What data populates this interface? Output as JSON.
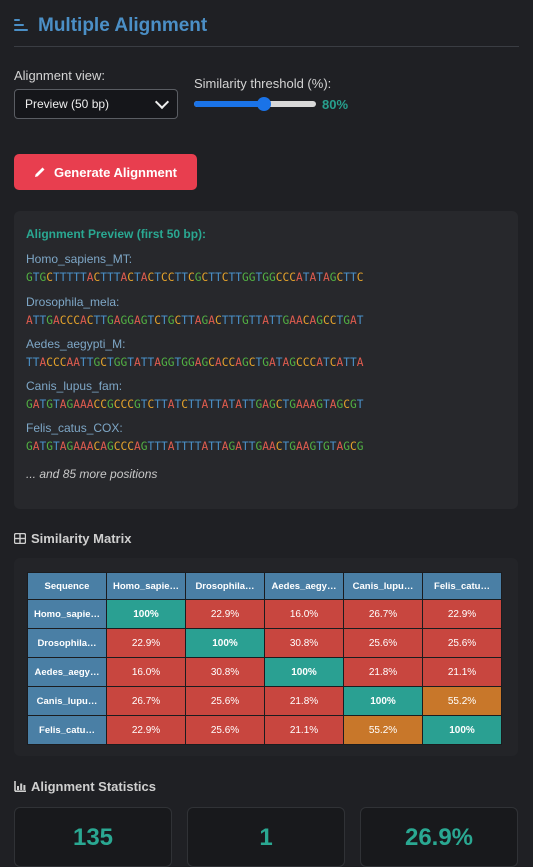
{
  "header": {
    "title": "Multiple Alignment",
    "icon": "align-left-icon"
  },
  "controls": {
    "view_label": "Alignment view:",
    "view_value": "Preview (50 bp)",
    "threshold_label": "Similarity threshold (%):",
    "threshold_value_text": "80%",
    "threshold_value": 80,
    "threshold_slider_fraction": 0.57
  },
  "generate_button": {
    "label": "Generate Alignment",
    "color": "#e83e4f"
  },
  "preview": {
    "title": "Alignment Preview (first 50 bp):",
    "sequences": [
      {
        "name": "Homo_sapiens_MT:",
        "seq": "GTGCTTTTTACTTTACTACTCCTTCGCTTCTTGGTGGCCCATATAGCTTC"
      },
      {
        "name": "Drosophila_mela:",
        "seq": "ATTGACCCACTTGAGGAGTCTGCTTAGACTTTGTTATTGAACAGCCTGAT"
      },
      {
        "name": "Aedes_aegypti_M:",
        "seq": "TTACCCAATTGCTGGTATTAGGTGGAGCACCAGCTGATAGCCCATCATTA"
      },
      {
        "name": "Canis_lupus_fam:",
        "seq": "GATGTAGAAACCGCCCGTCTTATCTTATTATATTGAGCTGAAAGTAGCGT"
      },
      {
        "name": "Felis_catus_COX:",
        "seq": "GATGTAGAAACAGCCCAGTTTATTTTATTAGATTGAACTGAAGTGTAGCG"
      }
    ],
    "more_text": "... and 85 more positions",
    "base_colors": {
      "A": "#e05c4f",
      "T": "#4a90c8",
      "G": "#52b043",
      "C": "#e5a32b"
    }
  },
  "similarity": {
    "title": "Similarity Matrix",
    "corner_header": "Sequence",
    "columns": [
      "Homo_sapie…",
      "Drosophila…",
      "Aedes_aegy…",
      "Canis_lupu…",
      "Felis_catu…"
    ],
    "rows": [
      {
        "label": "Homo_sapie…",
        "cells": [
          "100%",
          "22.9%",
          "16.0%",
          "26.7%",
          "22.9%"
        ]
      },
      {
        "label": "Drosophila…",
        "cells": [
          "22.9%",
          "100%",
          "30.8%",
          "25.6%",
          "25.6%"
        ]
      },
      {
        "label": "Aedes_aegy…",
        "cells": [
          "16.0%",
          "30.8%",
          "100%",
          "21.8%",
          "21.1%"
        ]
      },
      {
        "label": "Canis_lupu…",
        "cells": [
          "26.7%",
          "25.6%",
          "21.8%",
          "100%",
          "55.2%"
        ]
      },
      {
        "label": "Felis_catu…",
        "cells": [
          "22.9%",
          "25.6%",
          "21.1%",
          "55.2%",
          "100%"
        ]
      }
    ],
    "colors": {
      "high": "#2aa092",
      "mid": "#c8772a",
      "low": "#c8463f",
      "header": "#4a7fa5"
    }
  },
  "statistics": {
    "title": "Alignment Statistics",
    "cards": [
      "135",
      "1",
      "26.9%"
    ]
  }
}
